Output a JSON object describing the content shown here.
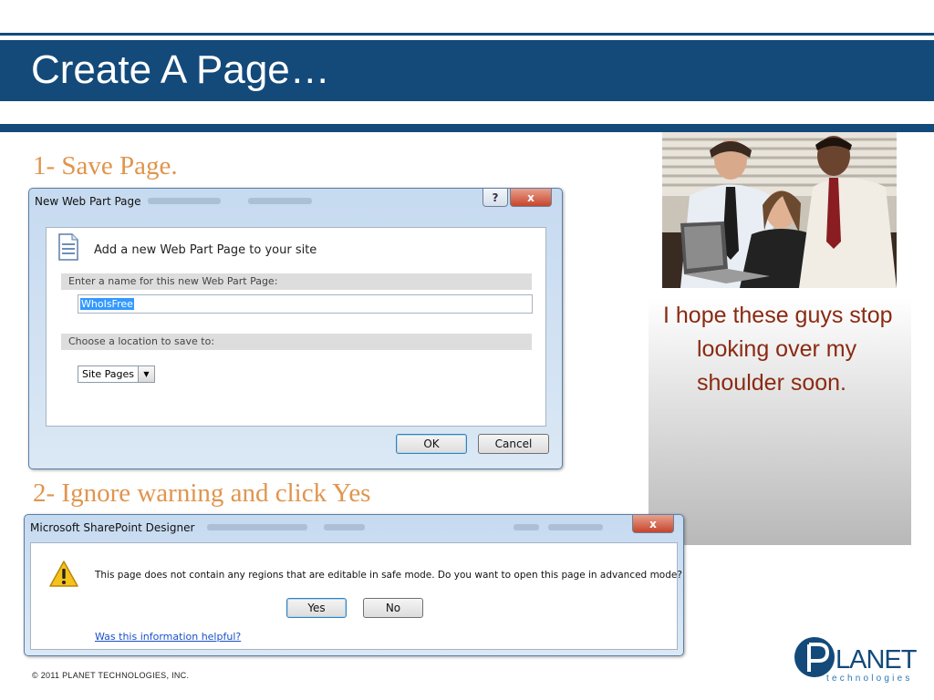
{
  "slide": {
    "title": "Create A Page…",
    "step1": "1- Save Page.",
    "step2": "2- Ignore warning and click Yes",
    "caption": "I hope these guys stop looking over my shoulder soon.",
    "footer": "© 2011 PLANET TECHNOLOGIES, INC."
  },
  "logo": {
    "text": "LANET",
    "sub": "technologies"
  },
  "dialog1": {
    "title": "New Web Part Page",
    "help_label": "?",
    "close_label": "x",
    "heading": "Add a new Web Part Page to your site",
    "name_section": "Enter a name for this new Web Part Page:",
    "name_value": "WhoIsFree",
    "location_section": "Choose a location to save to:",
    "location_value": "Site Pages",
    "ok_label": "OK",
    "cancel_label": "Cancel"
  },
  "dialog2": {
    "title": "Microsoft SharePoint Designer",
    "close_label": "x",
    "message": "This page does not contain any regions that are editable in safe mode. Do you want to open this page in advanced mode?",
    "yes_label": "Yes",
    "no_label": "No",
    "help_link": "Was this information helpful?"
  },
  "colors": {
    "brand_blue": "#134a7a",
    "step_orange": "#e0954d",
    "caption_red": "#8a2a12"
  }
}
